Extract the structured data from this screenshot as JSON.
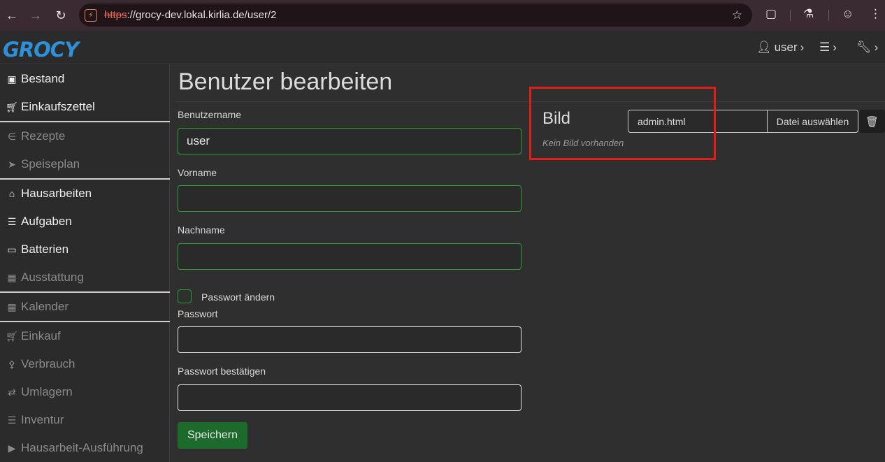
{
  "browser": {
    "url_scheme": "https",
    "url_rest": "://grocy-dev.lokal.kirlia.de/user/2"
  },
  "header": {
    "logo": "GROCY",
    "user_label": "user",
    "icons": [
      "user-icon",
      "sliders-icon",
      "wrench-icon"
    ]
  },
  "sidebar": {
    "items": [
      {
        "label": "Bestand",
        "icon": "box-icon",
        "muted": false
      },
      {
        "label": "Einkaufszettel",
        "icon": "cart-icon",
        "muted": false
      },
      {
        "label": "Rezepte",
        "icon": "rss-icon",
        "muted": true
      },
      {
        "label": "Speiseplan",
        "icon": "paper-plane-icon",
        "muted": true
      },
      {
        "label": "Hausarbeiten",
        "icon": "home-icon",
        "muted": false
      },
      {
        "label": "Aufgaben",
        "icon": "tasks-icon",
        "muted": false
      },
      {
        "label": "Batterien",
        "icon": "battery-icon",
        "muted": false
      },
      {
        "label": "Ausstattung",
        "icon": "toolbox-icon",
        "muted": true
      },
      {
        "label": "Kalender",
        "icon": "calendar-icon",
        "muted": true
      },
      {
        "label": "Einkauf",
        "icon": "cart-plus-icon",
        "muted": true
      },
      {
        "label": "Verbrauch",
        "icon": "utensils-icon",
        "muted": true
      },
      {
        "label": "Umlagern",
        "icon": "exchange-icon",
        "muted": true
      },
      {
        "label": "Inventur",
        "icon": "list-icon",
        "muted": true
      },
      {
        "label": "Hausarbeit-Ausführung",
        "icon": "play-icon",
        "muted": true
      }
    ]
  },
  "main": {
    "title": "Benutzer bearbeiten",
    "username_label": "Benutzername",
    "username_value": "user",
    "firstname_label": "Vorname",
    "firstname_value": "",
    "lastname_label": "Nachname",
    "lastname_value": "",
    "change_password_label": "Passwort ändern",
    "password_label": "Passwort",
    "password_value": "",
    "password_confirm_label": "Passwort bestätigen",
    "password_confirm_value": "",
    "save_label": "Speichern"
  },
  "picture": {
    "title": "Bild",
    "file_name": "admin.html",
    "choose_label": "Datei auswählen",
    "no_picture": "Kein Bild vorhanden"
  },
  "colors": {
    "accent_green": "#2f9d3a",
    "save_green": "#1d6b2c",
    "logo_blue": "#2f8fd7",
    "highlight_red": "#e21b1b"
  }
}
